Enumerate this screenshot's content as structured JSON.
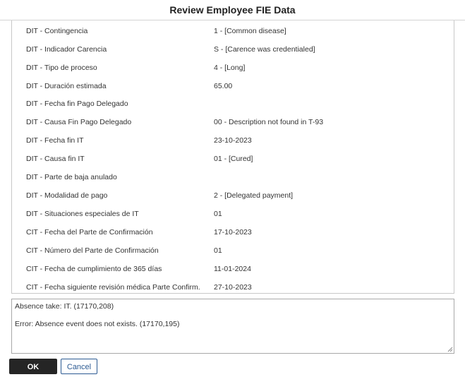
{
  "dialog": {
    "title": "Review Employee FIE Data"
  },
  "fields": [
    {
      "label": "DIT - Contingencia",
      "value": "1 - [Common disease]"
    },
    {
      "label": "DIT - Indicador Carencia",
      "value": "S - [Carence was credentialed]"
    },
    {
      "label": "DIT - Tipo de proceso",
      "value": "4 - [Long]"
    },
    {
      "label": "DIT - Duración estimada",
      "value": "65.00"
    },
    {
      "label": "DIT - Fecha fin Pago Delegado",
      "value": ""
    },
    {
      "label": "DIT - Causa Fin Pago Delegado",
      "value": "00 - Description not found in T-93"
    },
    {
      "label": "DIT - Fecha fin IT",
      "value": "23-10-2023"
    },
    {
      "label": "DIT - Causa fin IT",
      "value": "01 - [Cured]"
    },
    {
      "label": "DIT - Parte de baja anulado",
      "value": ""
    },
    {
      "label": "DIT - Modalidad de pago",
      "value": "2 - [Delegated payment]"
    },
    {
      "label": "DIT - Situaciones especiales de IT",
      "value": "01"
    },
    {
      "label": "CIT - Fecha del Parte de Confirmación",
      "value": "17-10-2023"
    },
    {
      "label": "CIT - Número del Parte de Confirmación",
      "value": "01"
    },
    {
      "label": "CIT - Fecha de cumplimiento de 365 días",
      "value": "11-01-2024"
    },
    {
      "label": "CIT - Fecha siguiente revisión médica Parte Confirm.",
      "value": "27-10-2023"
    }
  ],
  "messages": [
    "Absence take: IT. (17170,208)",
    "Error: Absence event does not exists. (17170,195)"
  ],
  "buttons": {
    "ok_label": "OK",
    "cancel_label": "Cancel"
  }
}
